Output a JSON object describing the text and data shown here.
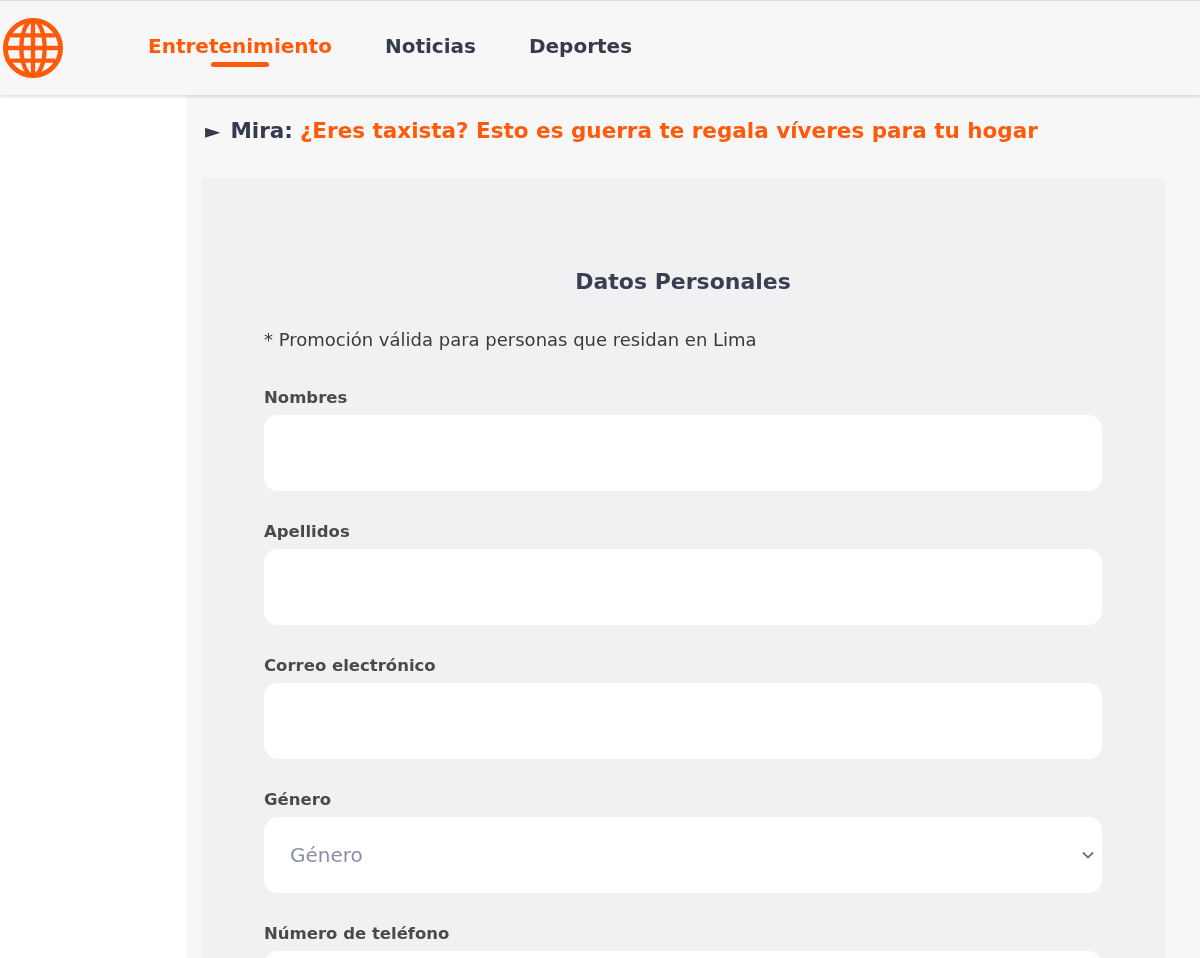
{
  "header": {
    "nav": [
      {
        "label": "Entretenimiento",
        "selected": true
      },
      {
        "label": "Noticias",
        "selected": false
      },
      {
        "label": "Deportes",
        "selected": false
      }
    ]
  },
  "promo": {
    "marker": "►",
    "prefix": "Mira:",
    "link": "¿Eres taxista? Esto es guerra te regala víveres para tu hogar"
  },
  "form": {
    "title": "Datos Personales",
    "note": "* Promoción válida para personas que residan en Lima",
    "fields": [
      {
        "kind": "text",
        "label": "Nombres"
      },
      {
        "kind": "text",
        "label": "Apellidos"
      },
      {
        "kind": "text",
        "label": "Correo electrónico"
      },
      {
        "kind": "select",
        "label": "Género",
        "placeholder": "Género"
      },
      {
        "kind": "text",
        "label": "Número de teléfono"
      }
    ]
  }
}
